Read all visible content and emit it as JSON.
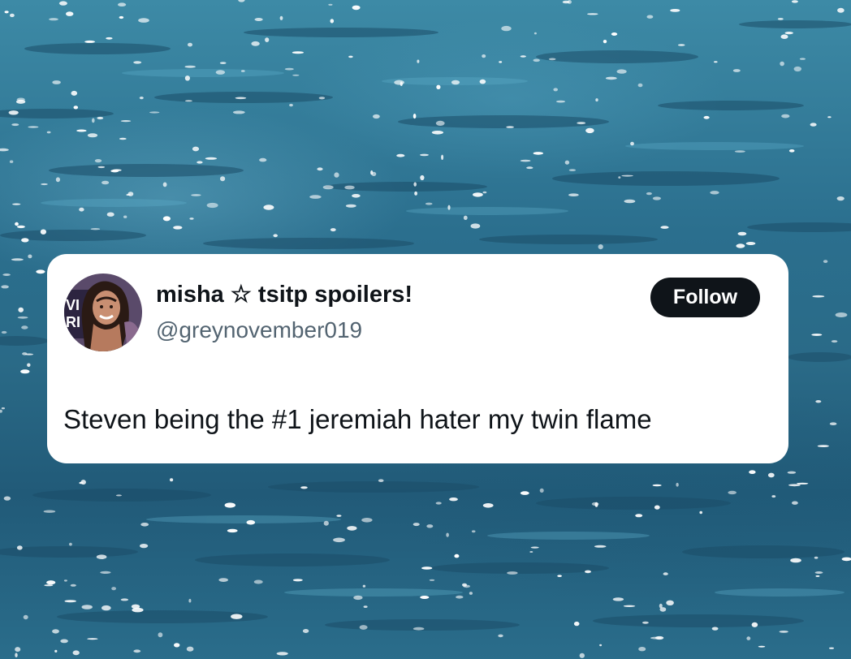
{
  "tweet": {
    "display_name": "misha ☆ tsitp spoilers!",
    "handle": "@greynovember019",
    "follow_label": "Follow",
    "text": "Steven being the #1 jeremiah hater my twin flame"
  },
  "colors": {
    "water": "#2b6f8e",
    "card": "#ffffff",
    "text": "#0f1419",
    "muted": "#536471",
    "button": "#0f1419"
  }
}
